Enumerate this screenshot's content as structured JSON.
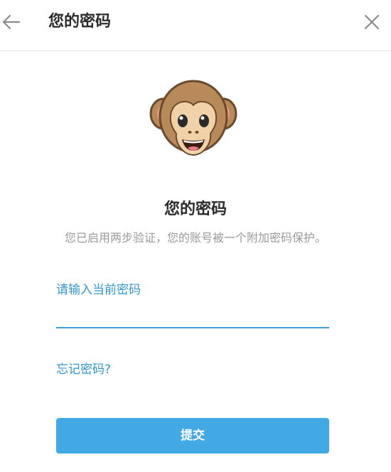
{
  "header": {
    "title": "您的密码",
    "back_icon": "arrow-left-icon",
    "close_icon": "close-icon"
  },
  "main": {
    "illustration_icon": "monkey-face-icon",
    "heading": "您的密码",
    "subtitle": "您已启用两步验证，您的账号被一个附加密码保护。",
    "password_label": "请输入当前密码",
    "password_value": "",
    "forgot_link": "忘记密码?",
    "submit_label": "提交"
  },
  "colors": {
    "accent": "#2f96cf",
    "button": "#43a9e4",
    "divider": "#e6e6e6"
  }
}
